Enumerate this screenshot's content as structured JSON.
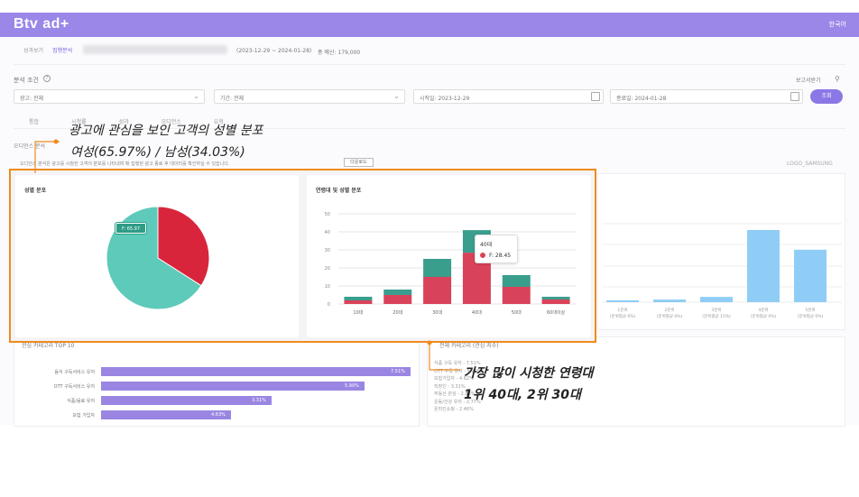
{
  "brand": "Btv ad+",
  "lang": "한국어",
  "tabs": [
    "성과보기",
    "집행분석"
  ],
  "period": "(2023-12-29 ~ 2024-01-28)",
  "budget": "총 예산: 179,000",
  "condition_title": "분석 조건",
  "report_link": "보고서받기",
  "filters": {
    "ad": "광고: 전체",
    "period_type": "기간: 전체",
    "start": "시작일: 2023-12-29",
    "end": "종료일: 2024-01-28",
    "search": "조회"
  },
  "subtabs": [
    "통합",
    "시청률",
    "성과",
    "오디언스",
    "유형"
  ],
  "audience_label": "오디언스 분석",
  "notice": "오디언스 분석은 광고를 시청한 고객의 분포를 나타내며 매 집행된 광고 종료 후 데이터를 확인하실 수 있습니다.",
  "download": "다운로드",
  "logo_alt": "LOGO_SAMSUNG",
  "annotations": {
    "gender_title": "광고에 관심을 보인 고객의 성별 분포",
    "gender_value": "여성(65.97%) / 남성(34.03%)",
    "age_title": "가장 많이 시청한 연령대",
    "age_value": "1위 40대, 2위 30대"
  },
  "gender_card": {
    "title": "성별 분포",
    "tag": "F: 65.97",
    "colors": {
      "female": "#5ecab9",
      "male": "#d9253c"
    }
  },
  "age_card": {
    "title": "연령대 및 성별 분포",
    "tooltip_title": "40대",
    "tooltip_label": "F: 28.45"
  },
  "chart_data": [
    {
      "type": "pie",
      "title": "성별 분포",
      "slices": [
        {
          "name": "F",
          "value": 65.97,
          "color": "#5ecab9"
        },
        {
          "name": "M",
          "value": 34.03,
          "color": "#d9253c"
        }
      ]
    },
    {
      "type": "bar",
      "title": "연령대 및 성별 분포",
      "stacked": true,
      "categories": [
        "10대",
        "20대",
        "30대",
        "40대",
        "50대",
        "60대이상"
      ],
      "ylim": [
        0,
        50
      ],
      "yticks": [
        0,
        10,
        20,
        30,
        40,
        50
      ],
      "series": [
        {
          "name": "F",
          "color": "#d9435a",
          "values": [
            2,
            5,
            15,
            28.45,
            9.5,
            2.5
          ]
        },
        {
          "name": "M",
          "color": "#3a9e8d",
          "values": [
            2,
            3,
            10,
            12.5,
            6.5,
            1.5
          ]
        }
      ]
    }
  ],
  "bg_chart": {
    "categories": [
      "1분위\n(분위평균 0%)",
      "2분위\n(분위평균 0%)",
      "3분위\n(분위평균 15%)",
      "4분위\n(분위평균 0%)",
      "5분위\n(분위평균 0%)"
    ],
    "values": [
      1,
      2,
      4,
      55,
      40
    ],
    "color": "#8fcdf6"
  },
  "top_interests": {
    "title": "관심 카테고리 TOP 10",
    "items": [
      {
        "label": "음식 구독서비스 유저",
        "value": "7.51%",
        "ratio": 1.0
      },
      {
        "label": "OTT 구독서비스 유저",
        "value": "5.90%",
        "ratio": 0.85
      },
      {
        "label": "식품/음료 유저",
        "value": "3.31%",
        "ratio": 0.55
      },
      {
        "label": "보험 가입자",
        "value": "4.63%",
        "ratio": 0.42
      }
    ]
  },
  "interest_list": {
    "title": "전체 카테고리 (관심 지수)",
    "items": [
      "식품 구독 유저 - 7.51%",
      "OTT 구독 유저 - 5.90%",
      "보험가입자 - 4.62%",
      "직장인 - 3.31%",
      "부동산 관심 - 2.86%",
      "운동/건강 유저 - 2.77%",
      "온라인쇼핑 - 2.46%"
    ]
  }
}
